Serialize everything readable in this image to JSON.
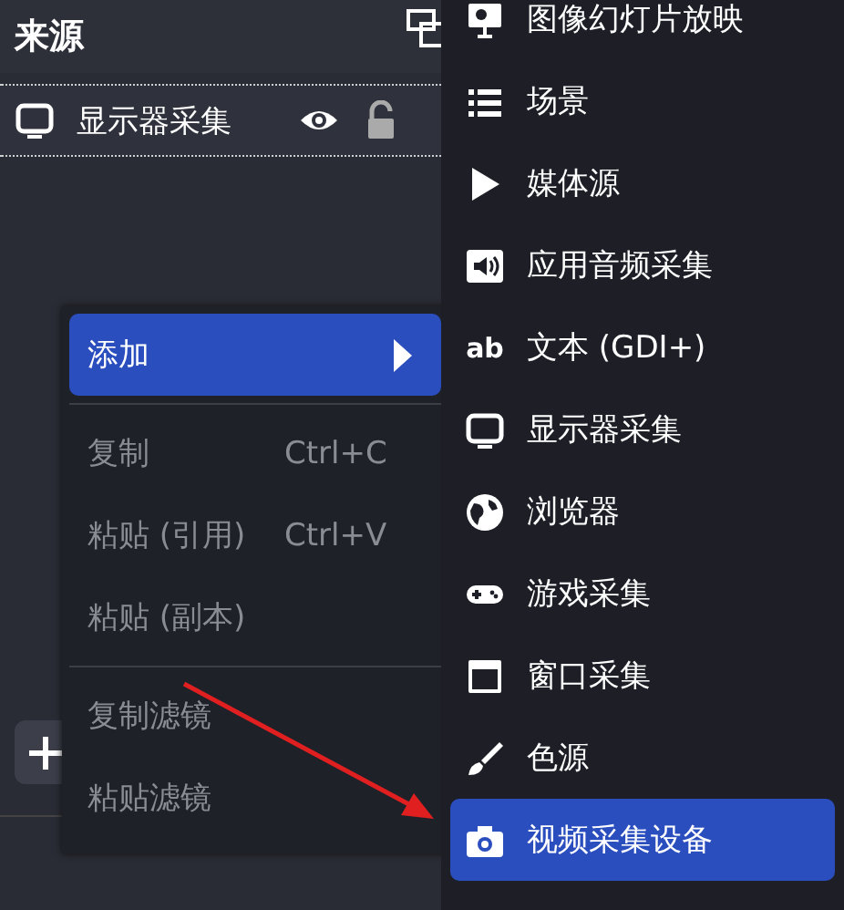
{
  "sources_panel": {
    "title": "来源",
    "sources": [
      {
        "name": "显示器采集",
        "visible": true,
        "locked": false
      }
    ]
  },
  "context_menu": {
    "items": [
      {
        "kind": "item",
        "label": "添加",
        "selected": true,
        "disabled": false,
        "submenu": true
      },
      {
        "kind": "separator"
      },
      {
        "kind": "item",
        "label": "复制",
        "shortcut": "Ctrl+C",
        "selected": false,
        "disabled": true,
        "submenu": false
      },
      {
        "kind": "item",
        "label": "粘贴 (引用)",
        "shortcut": "Ctrl+V",
        "selected": false,
        "disabled": true,
        "submenu": false
      },
      {
        "kind": "item",
        "label": "粘贴 (副本)",
        "selected": false,
        "disabled": true,
        "submenu": false
      },
      {
        "kind": "separator"
      },
      {
        "kind": "item",
        "label": "复制滤镜",
        "selected": false,
        "disabled": true,
        "submenu": false
      },
      {
        "kind": "item",
        "label": "粘贴滤镜",
        "selected": false,
        "disabled": true,
        "submenu": false
      }
    ]
  },
  "add_submenu": {
    "items": [
      {
        "kind": "slideshow",
        "label": "图像幻灯片放映",
        "selected": false
      },
      {
        "kind": "list",
        "label": "场景",
        "selected": false
      },
      {
        "kind": "play",
        "label": "媒体源",
        "selected": false
      },
      {
        "kind": "speaker",
        "label": "应用音频采集",
        "selected": false
      },
      {
        "kind": "text",
        "icon_label": "ab",
        "label": "文本 (GDI+)",
        "selected": false
      },
      {
        "kind": "monitor",
        "label": "显示器采集",
        "selected": false
      },
      {
        "kind": "globe",
        "label": "浏览器",
        "selected": false
      },
      {
        "kind": "gamepad",
        "label": "游戏采集",
        "selected": false
      },
      {
        "kind": "window",
        "label": "窗口采集",
        "selected": false
      },
      {
        "kind": "brush",
        "label": "色源",
        "selected": false
      },
      {
        "kind": "camera",
        "label": "视频采集设备",
        "selected": true
      }
    ]
  }
}
